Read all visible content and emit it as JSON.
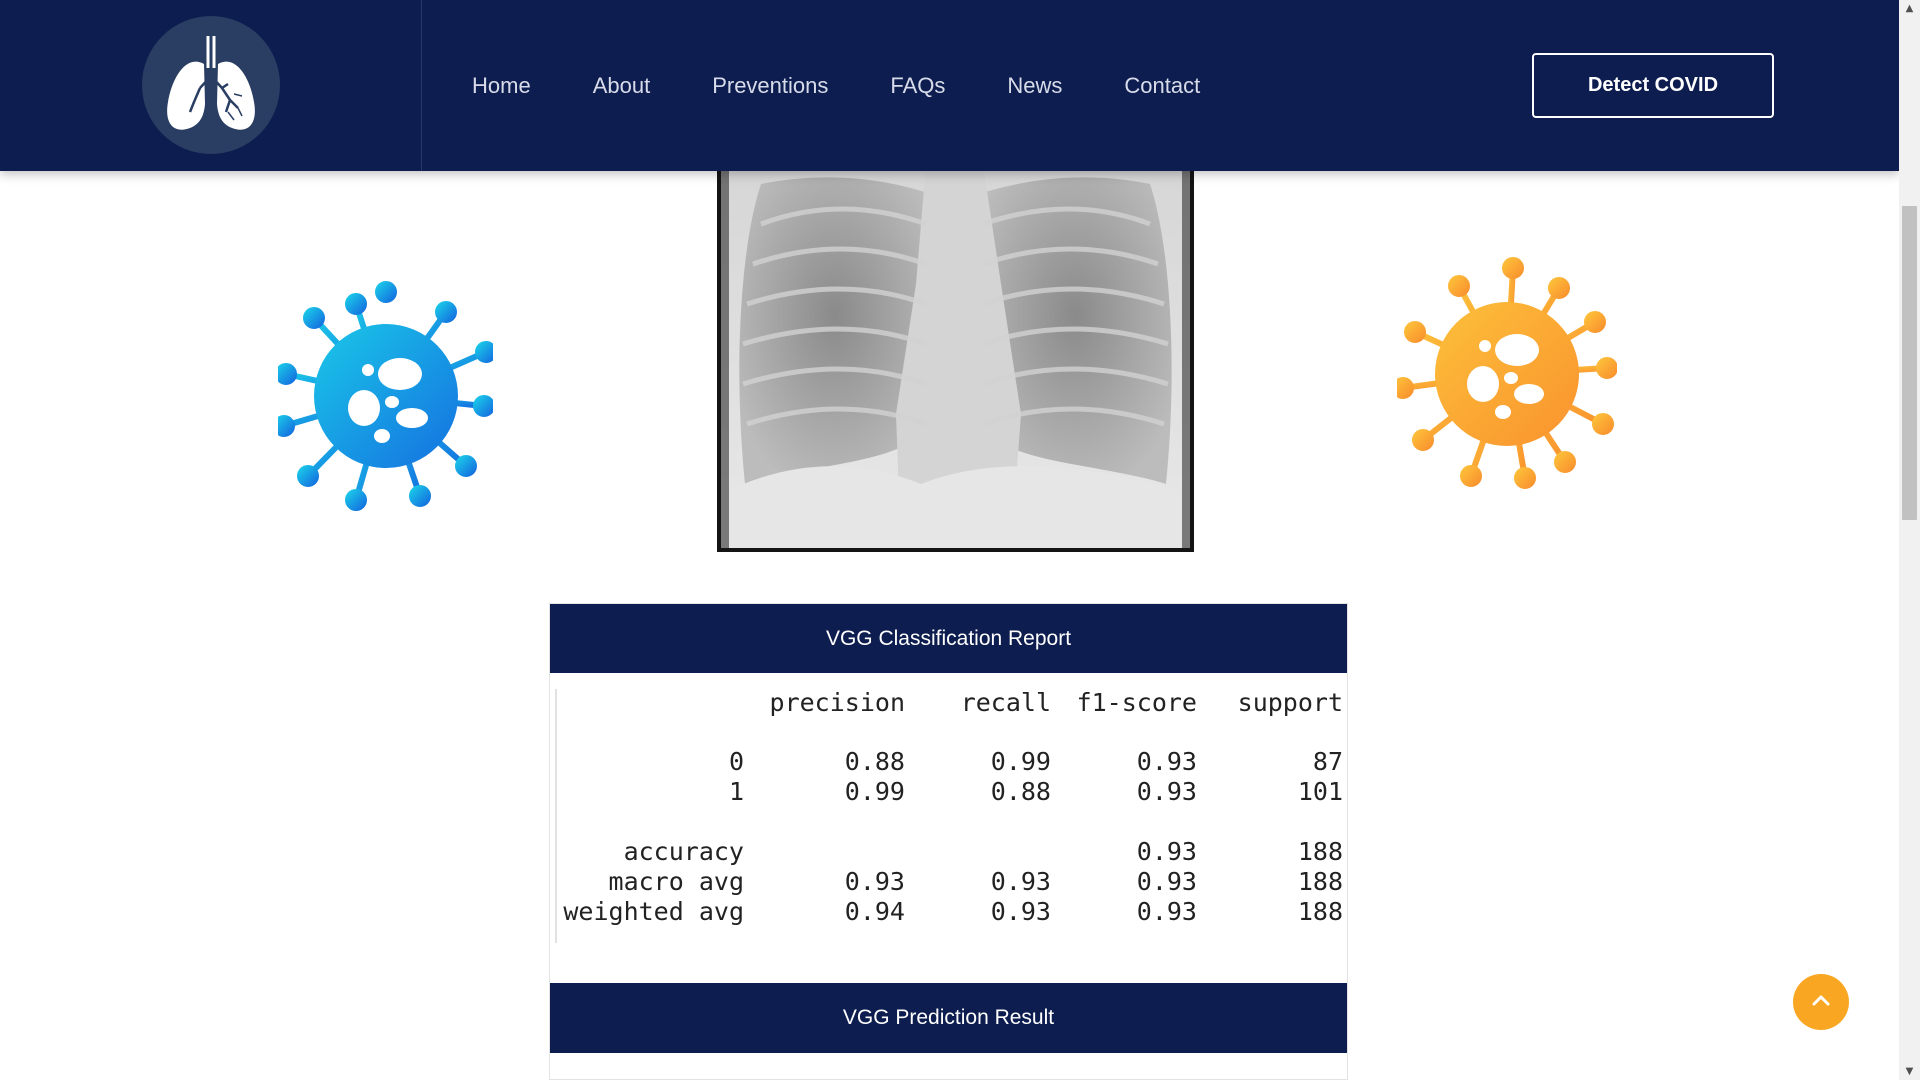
{
  "header": {
    "logo_icon": "lungs-icon",
    "nav": [
      "Home",
      "About",
      "Preventions",
      "FAQs",
      "News",
      "Contact"
    ],
    "cta_label": "Detect COVID"
  },
  "content": {
    "xray_icon": "chest-xray-image",
    "virus_left_color": "#1f8fe6",
    "virus_right_color": "#fba73a",
    "report_title": "VGG Classification Report",
    "report": {
      "columns": [
        "",
        "precision",
        "recall",
        "f1-score",
        "support"
      ],
      "rows": [
        [
          "0",
          "0.88",
          "0.99",
          "0.93",
          "87"
        ],
        [
          "1",
          "0.99",
          "0.88",
          "0.93",
          "101"
        ],
        [
          "accuracy",
          "",
          "",
          "0.93",
          "188"
        ],
        [
          "macro avg",
          "0.93",
          "0.93",
          "0.93",
          "188"
        ],
        [
          "weighted avg",
          "0.94",
          "0.93",
          "0.93",
          "188"
        ]
      ]
    },
    "prediction_title": "VGG Prediction Result"
  },
  "colors": {
    "navy": "#0d1d4f",
    "accent": "#f9a722"
  },
  "back_to_top_icon": "chevron-up-icon"
}
